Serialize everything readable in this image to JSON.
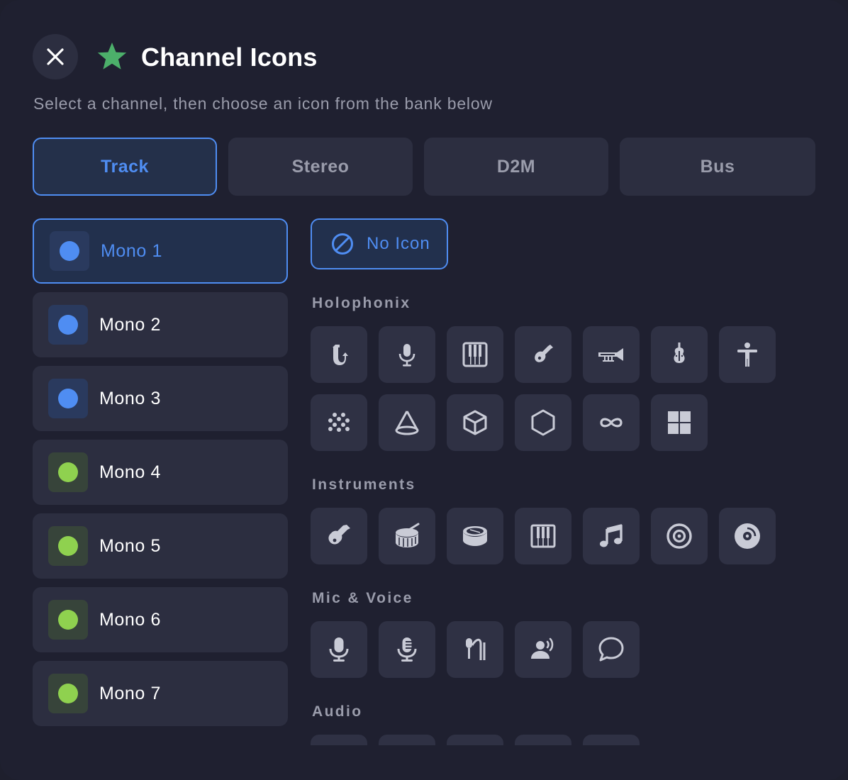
{
  "header": {
    "close_icon": "close-icon",
    "star_icon": "star-icon",
    "star_color": "#4caf6a",
    "title": "Channel Icons",
    "subtitle": "Select a channel, then choose an icon from the bank below"
  },
  "tabs": [
    {
      "label": "Track",
      "active": true
    },
    {
      "label": "Stereo",
      "active": false
    },
    {
      "label": "D2M",
      "active": false
    },
    {
      "label": "Bus",
      "active": false
    }
  ],
  "channels": [
    {
      "label": "Mono 1",
      "color": "#4f8df2",
      "active": true
    },
    {
      "label": "Mono 2",
      "color": "#4f8df2",
      "active": false
    },
    {
      "label": "Mono 3",
      "color": "#4f8df2",
      "active": false
    },
    {
      "label": "Mono 4",
      "color": "#8fd14f",
      "active": false
    },
    {
      "label": "Mono 5",
      "color": "#8fd14f",
      "active": false
    },
    {
      "label": "Mono 6",
      "color": "#8fd14f",
      "active": false
    },
    {
      "label": "Mono 7",
      "color": "#8fd14f",
      "active": false
    }
  ],
  "no_icon": {
    "label": "No Icon",
    "icon": "no-symbol-icon"
  },
  "sections": {
    "holophonix": {
      "title": "Holophonix",
      "icons": [
        "saxophone-icon",
        "microphone-icon",
        "keyboard-icon",
        "guitar-icon",
        "trumpet-icon",
        "violin-icon",
        "person-icon",
        "dots-cluster-icon",
        "cone-icon",
        "cube-icon",
        "hexagon-icon",
        "infinity-icon",
        "grid-icon"
      ]
    },
    "instruments": {
      "title": "Instruments",
      "icons": [
        "guitar-icon",
        "drum-icon",
        "snare-drum-icon",
        "piano-keys-icon",
        "music-note-icon",
        "record-disc-icon",
        "vinyl-icon"
      ]
    },
    "mic_voice": {
      "title": "Mic & Voice",
      "icons": [
        "microphone-icon",
        "microphone-lines-icon",
        "microphone-cable-icon",
        "person-speaking-icon",
        "speech-bubble-icon"
      ]
    },
    "audio": {
      "title": "Audio"
    }
  },
  "colors": {
    "accent": "#4f8df2",
    "green_dot": "#8fd14f",
    "background": "#1f2030",
    "tile": "#2f3144"
  }
}
